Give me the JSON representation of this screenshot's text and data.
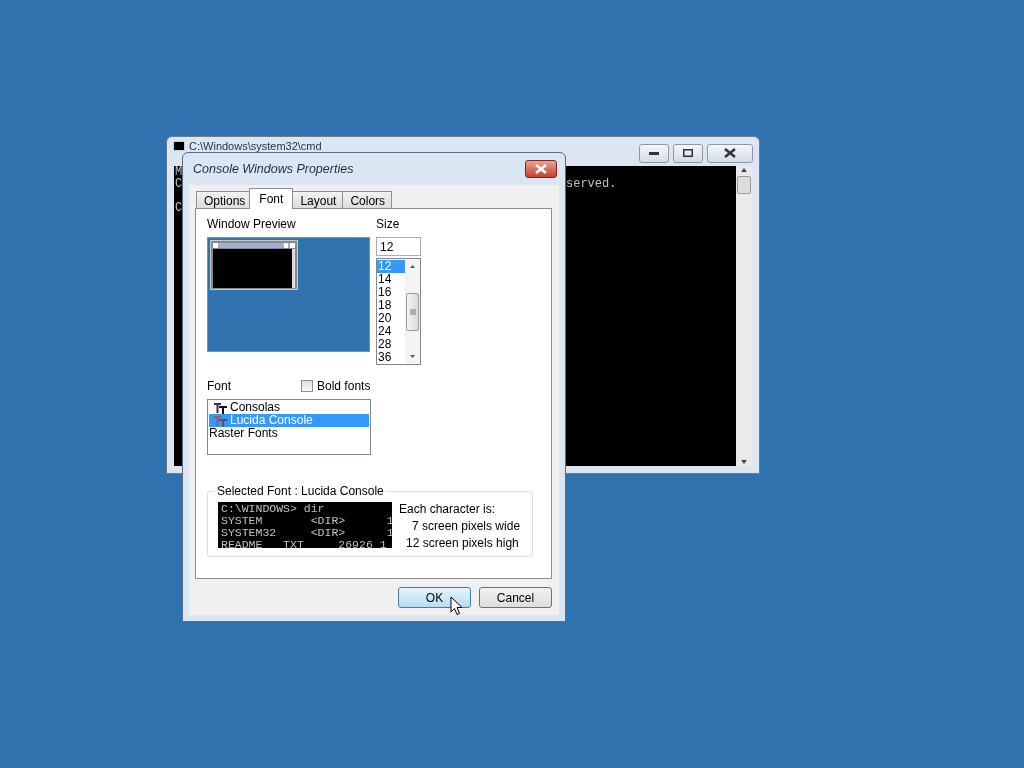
{
  "console_window": {
    "title": "C:\\Windows\\system32\\cmd",
    "left_lines": [
      "M",
      "C",
      "C"
    ],
    "right_text": "served."
  },
  "dialog": {
    "title": "Console Windows Properties",
    "tabs": [
      {
        "label": "Options",
        "selected": false
      },
      {
        "label": "Font",
        "selected": true
      },
      {
        "label": "Layout",
        "selected": false
      },
      {
        "label": "Colors",
        "selected": false
      }
    ],
    "window_preview_label": "Window Preview",
    "size": {
      "label": "Size",
      "value": "12",
      "options": [
        {
          "label": "12",
          "selected": true
        },
        {
          "label": "14",
          "selected": false
        },
        {
          "label": "16",
          "selected": false
        },
        {
          "label": "18",
          "selected": false
        },
        {
          "label": "20",
          "selected": false
        },
        {
          "label": "24",
          "selected": false
        },
        {
          "label": "28",
          "selected": false
        },
        {
          "label": "36",
          "selected": false
        }
      ]
    },
    "font": {
      "label": "Font",
      "bold_fonts": {
        "label": "Bold fonts",
        "checked": false
      },
      "options": [
        {
          "label": "Consolas",
          "kind": "truetype",
          "selected": false
        },
        {
          "label": "Lucida Console",
          "kind": "truetype",
          "selected": true
        },
        {
          "label": "Raster Fonts",
          "kind": "raster",
          "selected": false
        }
      ]
    },
    "selected_font": {
      "legend": "Selected Font : Lucida Console",
      "sample_lines": [
        "C:\\WINDOWS> dir",
        "SYSTEM       <DIR>      1",
        "SYSTEM32     <DIR>      1",
        "README   TXT     26926 1"
      ],
      "info_lines": [
        "Each character is:",
        "7 screen pixels wide",
        "12 screen pixels high"
      ]
    },
    "buttons": [
      {
        "label": "OK",
        "kind": "default"
      },
      {
        "label": "Cancel",
        "kind": "normal"
      }
    ]
  }
}
